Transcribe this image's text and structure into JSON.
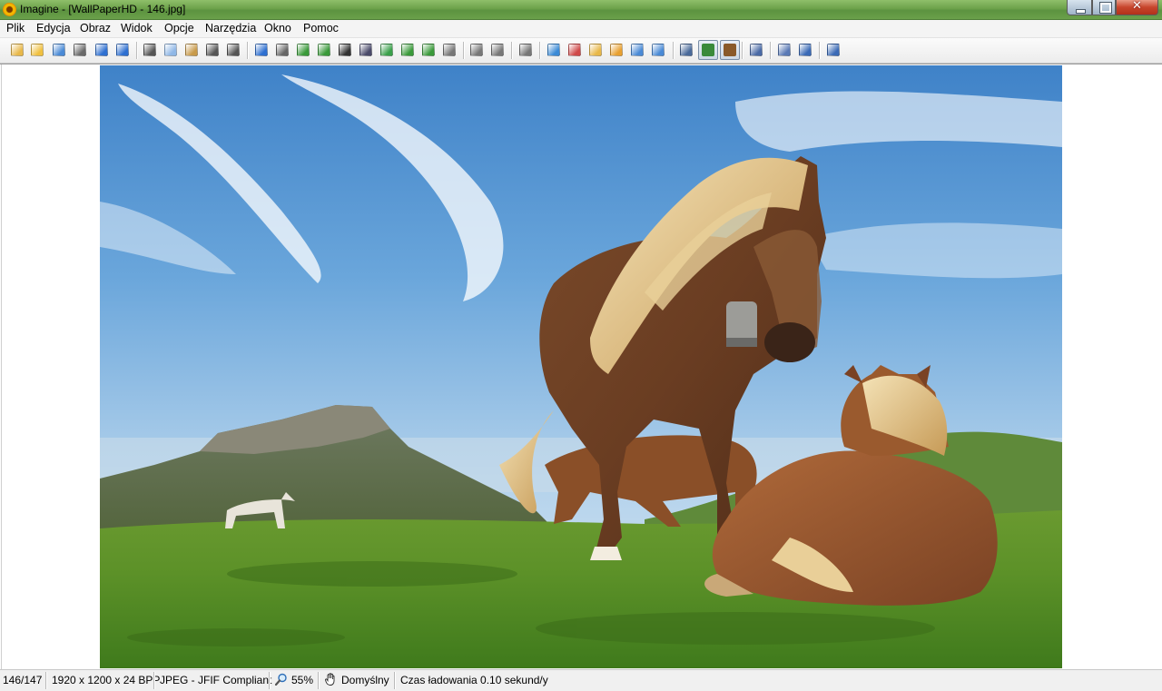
{
  "window": {
    "title": "Imagine - [WallPaperHD - 146.jpg]",
    "icon": "sunflower-app-icon",
    "controls": [
      "minimize-icon",
      "maximize-icon",
      "close-icon"
    ],
    "close_glyph": "✕"
  },
  "menu": [
    "Plik",
    "Edycja",
    "Obraz",
    "Widok",
    "Opcje",
    "Narzędzia",
    "Okno",
    "Pomoc"
  ],
  "toolbar": {
    "icons": [
      {
        "name": "new-icon",
        "color": "#e8b84a"
      },
      {
        "name": "open-folder-icon",
        "color": "#f0c040"
      },
      {
        "name": "save-icon",
        "color": "#4a8ad6"
      },
      {
        "name": "print-icon",
        "color": "#6a6a6a"
      },
      {
        "name": "previous-arrow-icon",
        "color": "#2d6fd1"
      },
      {
        "name": "next-arrow-icon",
        "color": "#2d6fd1"
      },
      {
        "name": "cut-icon",
        "color": "#555555"
      },
      {
        "name": "copy-icon",
        "color": "#8fb7e6"
      },
      {
        "name": "paste-icon",
        "color": "#c89a4a"
      },
      {
        "name": "undo-icon",
        "color": "#555555"
      },
      {
        "name": "redo-icon",
        "color": "#555555"
      },
      {
        "name": "info-icon",
        "color": "#2d6fd1"
      },
      {
        "name": "camera-icon",
        "color": "#666666"
      },
      {
        "name": "acquire-icon",
        "color": "#3a9a3a"
      },
      {
        "name": "scan-icon",
        "color": "#3a9a3a"
      },
      {
        "name": "gradient-icon",
        "color": "#333333"
      },
      {
        "name": "image-icon",
        "color": "#4a4a6a"
      },
      {
        "name": "color-adjust-icon",
        "color": "#3aa04a"
      },
      {
        "name": "convert-icon",
        "color": "#3a9a3a"
      },
      {
        "name": "rotate-icon",
        "color": "#3a9a3a"
      },
      {
        "name": "effects-icon",
        "color": "#777777"
      },
      {
        "name": "zoom-select-icon",
        "color": "#777777"
      },
      {
        "name": "crop-icon",
        "color": "#777777"
      },
      {
        "name": "refresh-icon",
        "color": "#777777"
      },
      {
        "name": "zoom-in-icon",
        "color": "#3a8ad6"
      },
      {
        "name": "zoom-out-icon",
        "color": "#d04a4a"
      },
      {
        "name": "zoom-fit-icon",
        "color": "#e8b84a"
      },
      {
        "name": "fit-window-icon",
        "color": "#e8a030"
      },
      {
        "name": "actual-size-icon",
        "color": "#4a8ad6"
      },
      {
        "name": "fullscreen-icon",
        "color": "#4a8ad6"
      },
      {
        "name": "monitor-icon",
        "color": "#4a6a9a"
      },
      {
        "name": "slideshow-icon",
        "color": "#3a8a3a",
        "pressed": true
      },
      {
        "name": "paint-brush-icon",
        "color": "#8a5a2a",
        "pressed": true
      },
      {
        "name": "wrench-icon",
        "color": "#4a6aa6"
      },
      {
        "name": "thumbnails-icon",
        "color": "#5a7ab6"
      },
      {
        "name": "batch-icon",
        "color": "#3a6ab6"
      },
      {
        "name": "help-icon",
        "color": "#3a6ab6"
      }
    ]
  },
  "image": {
    "description_icon": "photo-horses-icon"
  },
  "status": {
    "index": "146/147",
    "dimensions": "1920 x 1200 x 24 BPP",
    "format": "JPEG - JFIF Compliant",
    "zoom": "55%",
    "mode": "Domyślny",
    "load_time": "Czas ładowania 0.10 sekund/y"
  }
}
